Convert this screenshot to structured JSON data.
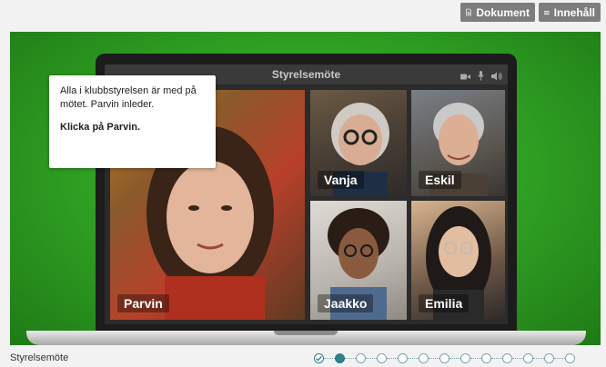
{
  "toolbar": {
    "document_label": "Dokument",
    "contents_label": "Innehåll"
  },
  "meeting": {
    "window_title": "Styrelsemöte",
    "participants": [
      "Parvin",
      "Vanja",
      "Eskil",
      "Jaakko",
      "Emilia"
    ]
  },
  "callout": {
    "body": "Alla i klubbstyrelsen är med på mötet. Parvin inleder.",
    "cta": "Klicka på Parvin."
  },
  "footer": {
    "title": "Styrelsemöte"
  },
  "progress": {
    "total_steps": 13,
    "completed_steps": 1,
    "current_step": 2
  },
  "colors": {
    "stage_green": "#2e9e22",
    "progress_teal": "#2f7f8c",
    "toolbar_grey": "#7d7d7d"
  }
}
